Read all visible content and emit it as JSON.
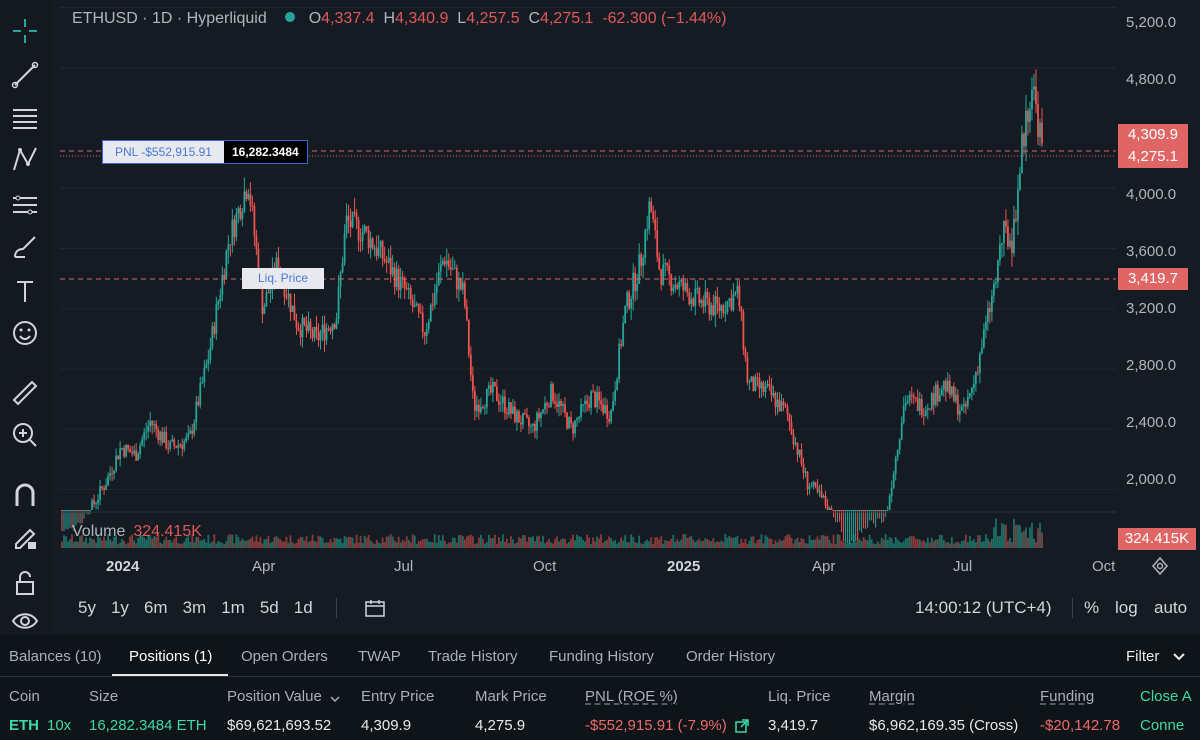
{
  "legend": {
    "symbol": "ETHUSD · 1D · Hyperliquid",
    "o_label": "O",
    "o": "4,337.4",
    "h_label": "H",
    "h": "4,340.9",
    "l_label": "L",
    "l": "4,257.5",
    "c_label": "C",
    "c": "4,275.1",
    "change": "-62.300 (−1.44%)"
  },
  "y_axis": [
    "5,200.0",
    "4,800.0",
    "4,000.0",
    "3,600.0",
    "3,200.0",
    "2,800.0",
    "2,400.0",
    "2,000.0"
  ],
  "price_tags": {
    "entry": "4,309.9",
    "last": "4,275.1",
    "liq": "3,419.7",
    "volume": "324.415K"
  },
  "position_line": {
    "pnl_label": "PNL -$552,915.91",
    "size": "16,282.3484"
  },
  "liq_line": {
    "label": "Liq. Price"
  },
  "volume_legend": {
    "label": "Volume",
    "value": "324.415K"
  },
  "x_axis": [
    "2024",
    "Apr",
    "Jul",
    "Oct",
    "2025",
    "Apr",
    "Jul",
    "Oct"
  ],
  "ranges": [
    "5y",
    "1y",
    "6m",
    "3m",
    "1m",
    "5d",
    "1d"
  ],
  "clock": "14:00:12 (UTC+4)",
  "scale_opts": {
    "pct": "%",
    "log": "log",
    "auto": "auto"
  },
  "tabs": [
    "Balances (10)",
    "Positions (1)",
    "Open Orders",
    "TWAP",
    "Trade History",
    "Funding History",
    "Order History"
  ],
  "filter": "Filter",
  "columns": [
    "Coin",
    "Size",
    "Position Value",
    "Entry Price",
    "Mark Price",
    "PNL (ROE %)",
    "Liq. Price",
    "Margin",
    "Funding",
    "Close A"
  ],
  "row": {
    "coin": "ETH",
    "lev": "10x",
    "size": "16,282.3484 ETH",
    "value": "$69,621,693.52",
    "entry": "4,309.9",
    "mark": "4,275.9",
    "pnl": "-$552,915.91 (-7.9%)",
    "liq": "3,419.7",
    "margin": "$6,962,169.35 (Cross)",
    "funding": "-$20,142.78",
    "close": "Conne"
  },
  "colors": {
    "up": "#26a69a",
    "down": "#ef5350",
    "tag": "#e06666",
    "bg": "#151b22"
  },
  "chart_data": {
    "type": "candlestick",
    "title": "ETHUSD · 1D · Hyperliquid",
    "y_range": [
      1850,
      5250
    ],
    "series": [
      {
        "t": 0,
        "p": 1700
      },
      {
        "t": 0.02,
        "p": 1760
      },
      {
        "t": 0.045,
        "p": 2050
      },
      {
        "t": 0.06,
        "p": 2280
      },
      {
        "t": 0.075,
        "p": 2230
      },
      {
        "t": 0.09,
        "p": 2450
      },
      {
        "t": 0.11,
        "p": 2280
      },
      {
        "t": 0.13,
        "p": 2330
      },
      {
        "t": 0.15,
        "p": 2900
      },
      {
        "t": 0.17,
        "p": 3650
      },
      {
        "t": 0.19,
        "p": 4050
      },
      {
        "t": 0.205,
        "p": 3200
      },
      {
        "t": 0.22,
        "p": 3500
      },
      {
        "t": 0.24,
        "p": 3100
      },
      {
        "t": 0.26,
        "p": 3000
      },
      {
        "t": 0.28,
        "p": 3150
      },
      {
        "t": 0.29,
        "p": 3780
      },
      {
        "t": 0.31,
        "p": 3700
      },
      {
        "t": 0.33,
        "p": 3520
      },
      {
        "t": 0.35,
        "p": 3320
      },
      {
        "t": 0.37,
        "p": 3050
      },
      {
        "t": 0.39,
        "p": 3550
      },
      {
        "t": 0.41,
        "p": 3300
      },
      {
        "t": 0.42,
        "p": 2550
      },
      {
        "t": 0.44,
        "p": 2650
      },
      {
        "t": 0.46,
        "p": 2500
      },
      {
        "t": 0.48,
        "p": 2400
      },
      {
        "t": 0.5,
        "p": 2650
      },
      {
        "t": 0.52,
        "p": 2400
      },
      {
        "t": 0.54,
        "p": 2620
      },
      {
        "t": 0.56,
        "p": 2500
      },
      {
        "t": 0.575,
        "p": 3200
      },
      {
        "t": 0.59,
        "p": 3500
      },
      {
        "t": 0.6,
        "p": 3900
      },
      {
        "t": 0.61,
        "p": 3450
      },
      {
        "t": 0.63,
        "p": 3350
      },
      {
        "t": 0.65,
        "p": 3250
      },
      {
        "t": 0.67,
        "p": 3200
      },
      {
        "t": 0.69,
        "p": 3300
      },
      {
        "t": 0.7,
        "p": 2700
      },
      {
        "t": 0.72,
        "p": 2650
      },
      {
        "t": 0.74,
        "p": 2500
      },
      {
        "t": 0.76,
        "p": 2050
      },
      {
        "t": 0.78,
        "p": 1900
      },
      {
        "t": 0.8,
        "p": 1580
      },
      {
        "t": 0.82,
        "p": 1700
      },
      {
        "t": 0.84,
        "p": 1780
      },
      {
        "t": 0.86,
        "p": 2600
      },
      {
        "t": 0.88,
        "p": 2550
      },
      {
        "t": 0.9,
        "p": 2700
      },
      {
        "t": 0.92,
        "p": 2500
      },
      {
        "t": 0.93,
        "p": 2700
      },
      {
        "t": 0.95,
        "p": 3300
      },
      {
        "t": 0.96,
        "p": 3700
      },
      {
        "t": 0.97,
        "p": 3650
      },
      {
        "t": 0.98,
        "p": 4300
      },
      {
        "t": 0.99,
        "p": 4700
      },
      {
        "t": 1.0,
        "p": 4275
      }
    ]
  }
}
